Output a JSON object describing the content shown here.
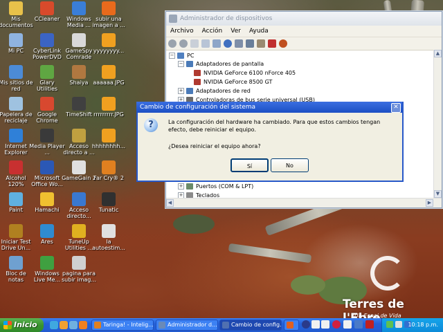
{
  "desktop": {
    "icons": [
      {
        "label": "Mis documentos",
        "color": "#e8c14a"
      },
      {
        "label": "CCleaner",
        "color": "#d84a2b"
      },
      {
        "label": "Windows Media ...",
        "color": "#3a7ed8"
      },
      {
        "label": "subir una imagen a ...",
        "color": "#e86a1c"
      },
      {
        "label": "Mi PC",
        "color": "#8fb3e0"
      },
      {
        "label": "CyberLink PowerDVD",
        "color": "#3b64c4"
      },
      {
        "label": "GameSpy Comrade",
        "color": "#d9d9d9"
      },
      {
        "label": "yyyyyyyy...",
        "color": "#f0a020"
      },
      {
        "label": "Mis sitios de red",
        "color": "#4c8bd6"
      },
      {
        "label": "Glary Utilities",
        "color": "#5fa642"
      },
      {
        "label": "Shaiya",
        "color": "#b07840"
      },
      {
        "label": "aaaaaa.JPG",
        "color": "#f0a020"
      },
      {
        "label": "Papelera de reciclaje",
        "color": "#9fc2e0"
      },
      {
        "label": "Google Chrome",
        "color": "#d8482f"
      },
      {
        "label": "TimeShift",
        "color": "#404040"
      },
      {
        "label": "rrrrrrrrr.JPG",
        "color": "#f0a020"
      },
      {
        "label": "Internet Explorer",
        "color": "#2f80d8"
      },
      {
        "label": "Media Player ...",
        "color": "#3a3a3a"
      },
      {
        "label": "Acceso directo a ...",
        "color": "#c0a040"
      },
      {
        "label": "hhhhhhhh...",
        "color": "#f0a020"
      },
      {
        "label": "Alcohol 120%",
        "color": "#c83030"
      },
      {
        "label": "Microsoft Office Wo...",
        "color": "#2b58b5"
      },
      {
        "label": "GameGain 2",
        "color": "#e0e0e0"
      },
      {
        "label": "Far Cry® 2",
        "color": "#e08020"
      },
      {
        "label": "Paint",
        "color": "#5fb0e0"
      },
      {
        "label": "Hamachi",
        "color": "#f0c030"
      },
      {
        "label": "Acceso directo...",
        "color": "#3a78d0"
      },
      {
        "label": "Tunatic",
        "color": "#303030"
      },
      {
        "label": "Iniciar Test Drive Un...",
        "color": "#b08020"
      },
      {
        "label": "Ares",
        "color": "#2f8bd0"
      },
      {
        "label": "TuneUp Utilities ...",
        "color": "#e0b020"
      },
      {
        "label": "la autoestim...",
        "color": "#e0e0e0"
      },
      {
        "label": "Bloc de notas",
        "color": "#6fa0d0"
      },
      {
        "label": "Windows Live Me...",
        "color": "#3fa040"
      },
      {
        "label": "pagina para subir imag...",
        "color": "#d0d0d0"
      }
    ]
  },
  "devmgr": {
    "title": "Administrador de dispositivos",
    "menu": [
      "Archivo",
      "Acción",
      "Ver",
      "Ayuda"
    ],
    "tree": [
      {
        "label": "PC",
        "pm": "−",
        "indent": 0,
        "color": "#5080c0"
      },
      {
        "label": "Adaptadores de pantalla",
        "pm": "−",
        "indent": 1,
        "color": "#4a7ab8"
      },
      {
        "label": "NVIDIA GeForce 6100 nForce 405",
        "pm": "",
        "indent": 2,
        "color": "#b03a30"
      },
      {
        "label": "NVIDIA GeForce 8500 GT",
        "pm": "",
        "indent": 2,
        "color": "#b03a30"
      },
      {
        "label": "Adaptadores de red",
        "pm": "+",
        "indent": 1,
        "color": "#4a7ab8"
      },
      {
        "label": "Controladoras de bus serie universal (USB)",
        "pm": "+",
        "indent": 1,
        "color": "#6a6a6a"
      },
      {
        "label": "Puertos (COM & LPT)",
        "pm": "+",
        "indent": 1,
        "color": "#6a8a6a"
      },
      {
        "label": "Teclados",
        "pm": "+",
        "indent": 1,
        "color": "#8a8a8a"
      }
    ]
  },
  "dialog": {
    "title": "Cambio de configuración del sistema",
    "message": "La configuración del hardware ha cambiado. Para que estos cambios tengan efecto, debe reiniciar el equipo.",
    "question": "¿Desea reiniciar el equipo ahora?",
    "yes": "Sí",
    "no": "No",
    "close": "✕"
  },
  "wallpaper": {
    "brand": "Terres de l'Ebre",
    "tagline": "Un Espai de Vida"
  },
  "taskbar": {
    "start": "Inicio",
    "tasks": [
      {
        "label": "Taringa! - Intelig...",
        "color": "#e08020",
        "active": false
      },
      {
        "label": "Administrador d...",
        "color": "#6a8ab8",
        "active": false
      },
      {
        "label": "Cambio de config...",
        "color": "#5070b0",
        "active": true
      },
      {
        "label": "",
        "color": "#e06020",
        "active": false
      }
    ],
    "clock": "10:18 p.m."
  }
}
